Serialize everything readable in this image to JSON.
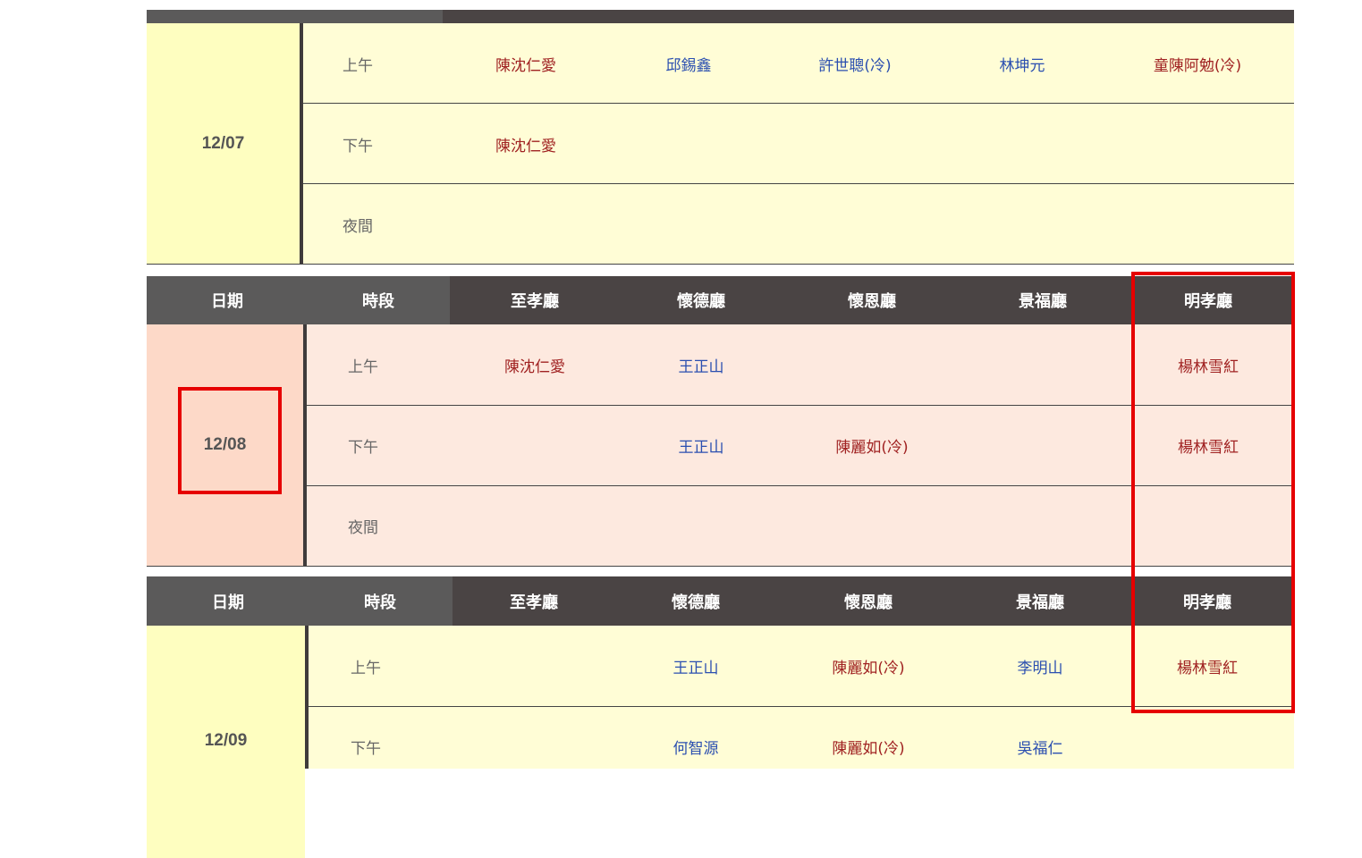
{
  "headers": [
    "日期",
    "時段",
    "至孝廳",
    "懷德廳",
    "懷恩廳",
    "景福廳",
    "明孝廳"
  ],
  "days": [
    {
      "date": "12/07",
      "rows": [
        {
          "slot": "上午",
          "cells": [
            {
              "text": "陳沈仁愛",
              "c": "red"
            },
            {
              "text": "邱錫鑫",
              "c": "blue"
            },
            {
              "text": "許世聰(冷)",
              "c": "blue"
            },
            {
              "text": "林坤元",
              "c": "blue"
            },
            {
              "text": "童陳阿勉(冷)",
              "c": "red"
            }
          ]
        },
        {
          "slot": "下午",
          "cells": [
            {
              "text": "陳沈仁愛",
              "c": "red"
            },
            {
              "text": "",
              "c": ""
            },
            {
              "text": "",
              "c": ""
            },
            {
              "text": "",
              "c": ""
            },
            {
              "text": "",
              "c": ""
            }
          ]
        },
        {
          "slot": "夜間",
          "cells": [
            {
              "text": "",
              "c": ""
            },
            {
              "text": "",
              "c": ""
            },
            {
              "text": "",
              "c": ""
            },
            {
              "text": "",
              "c": ""
            },
            {
              "text": "",
              "c": ""
            }
          ]
        }
      ]
    },
    {
      "date": "12/08",
      "rows": [
        {
          "slot": "上午",
          "cells": [
            {
              "text": "陳沈仁愛",
              "c": "red"
            },
            {
              "text": "王正山",
              "c": "blue"
            },
            {
              "text": "",
              "c": ""
            },
            {
              "text": "",
              "c": ""
            },
            {
              "text": "楊林雪紅",
              "c": "red"
            }
          ]
        },
        {
          "slot": "下午",
          "cells": [
            {
              "text": "",
              "c": ""
            },
            {
              "text": "王正山",
              "c": "blue"
            },
            {
              "text": "陳麗如(冷)",
              "c": "red"
            },
            {
              "text": "",
              "c": ""
            },
            {
              "text": "楊林雪紅",
              "c": "red"
            }
          ]
        },
        {
          "slot": "夜間",
          "cells": [
            {
              "text": "",
              "c": ""
            },
            {
              "text": "",
              "c": ""
            },
            {
              "text": "",
              "c": ""
            },
            {
              "text": "",
              "c": ""
            },
            {
              "text": "",
              "c": ""
            }
          ]
        }
      ]
    },
    {
      "date": "12/09",
      "rows": [
        {
          "slot": "上午",
          "cells": [
            {
              "text": "",
              "c": ""
            },
            {
              "text": "王正山",
              "c": "blue"
            },
            {
              "text": "陳麗如(冷)",
              "c": "red"
            },
            {
              "text": "李明山",
              "c": "blue"
            },
            {
              "text": "楊林雪紅",
              "c": "red"
            }
          ]
        },
        {
          "slot": "下午",
          "cells": [
            {
              "text": "",
              "c": ""
            },
            {
              "text": "何智源",
              "c": "blue"
            },
            {
              "text": "陳麗如(冷)",
              "c": "red"
            },
            {
              "text": "吳福仁",
              "c": "blue"
            },
            {
              "text": "",
              "c": ""
            }
          ]
        }
      ]
    }
  ],
  "colors": {
    "highlight": "#e60000",
    "header_gray": "#5b5a5a",
    "header_dark": "#4a4444",
    "yellow_date": "#fefec0",
    "yellow_row": "#fffdd6",
    "pink_date": "#fdd9c8",
    "pink_row": "#fde9df"
  }
}
